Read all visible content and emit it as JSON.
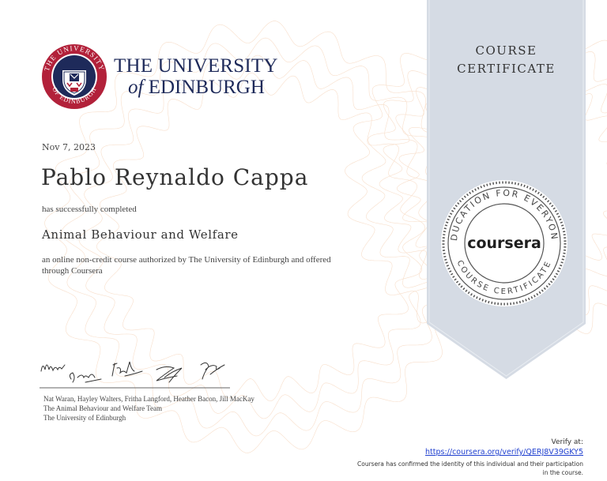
{
  "university": {
    "name_line1": "THE UNIVERSITY",
    "name_line2_of": "of",
    "name_line2_rest": "EDINBURGH",
    "seal_text_top": "THE UNIVERSITY",
    "seal_text_bottom": "OF EDINBURGH",
    "colors": {
      "navy": "#1e2a5a",
      "red": "#b2213a"
    }
  },
  "certificate": {
    "date": "Nov 7, 2023",
    "recipient": "Pablo Reynaldo Cappa",
    "completed_text": "has successfully completed",
    "course_name": "Animal Behaviour and Welfare",
    "description": "an online non-credit course authorized by The University of Edinburgh and offered through Coursera"
  },
  "signatories": {
    "names": "Nat Waran, Hayley Walters, Fritha Langford, Heather Bacon, Jill MacKay",
    "team": "The Animal Behaviour and Welfare Team",
    "institution": "The University of Edinburgh"
  },
  "ribbon": {
    "title_line1": "COURSE",
    "title_line2": "CERTIFICATE",
    "badge_top_text": "EDUCATION FOR EVERYONE",
    "badge_bottom_text": "COURSE CERTIFICATE",
    "badge_logo": "coursera",
    "colors": {
      "ribbon": "#d5dbe4",
      "badge": "#ffffff"
    }
  },
  "verification": {
    "label": "Verify at:",
    "link": "https://coursera.org/verify/QERJ8V39GKY5",
    "confirm_text": "Coursera has confirmed the identity of this individual and their participation in the course."
  }
}
